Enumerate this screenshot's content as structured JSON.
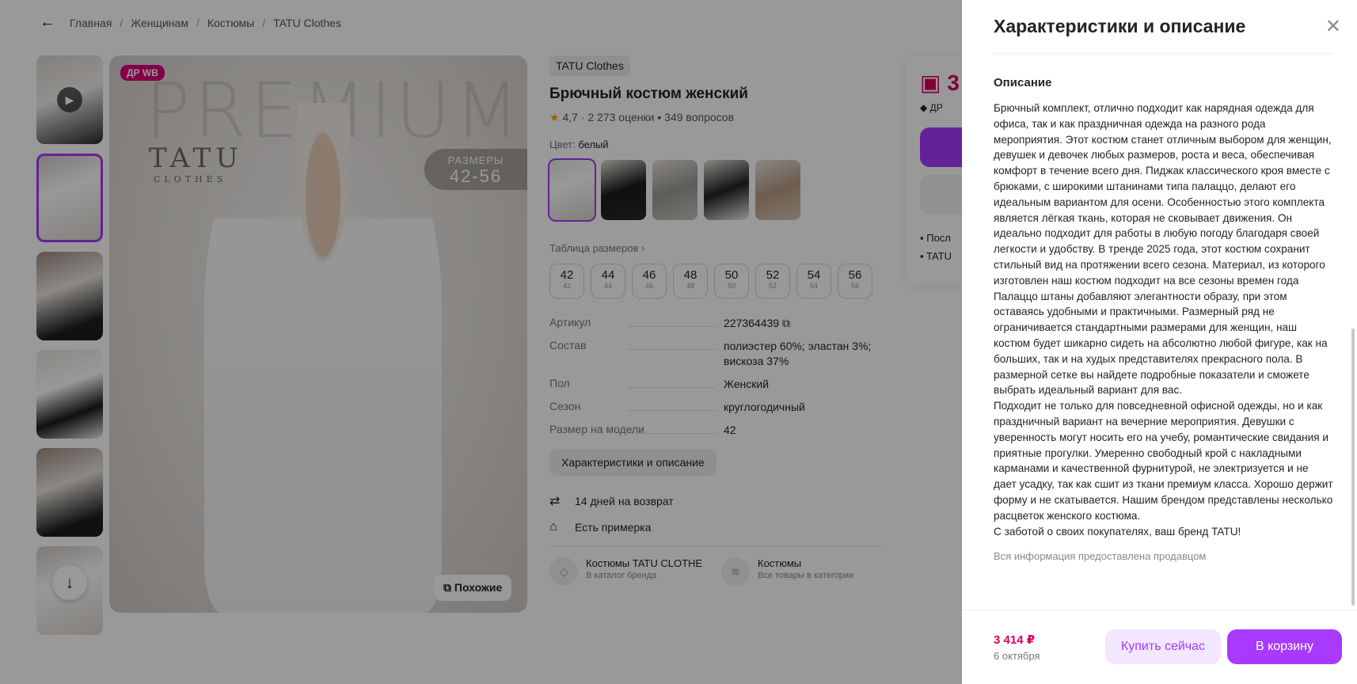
{
  "breadcrumbs": [
    "Главная",
    "Женщинам",
    "Костюмы",
    "TATU Clothes"
  ],
  "gallery": {
    "badge": "ДР WB",
    "watermark": "PREMIUM",
    "brand_logo": "TATU",
    "brand_logo_sub": "CLOTHES",
    "sizes_title": "РАЗМЕРЫ",
    "sizes_range": "42-56",
    "similar_label": "Похожие"
  },
  "product": {
    "brand": "TATU Clothes",
    "title": "Брючный костюм женский",
    "rating": "4,7",
    "reviews": "2 273 оценки",
    "questions": "349 вопросов",
    "color_label": "Цвет:",
    "color_value": "белый",
    "size_table_link": "Таблица размеров",
    "sizes": [
      {
        "ru": "42",
        "alt": "42"
      },
      {
        "ru": "44",
        "alt": "44"
      },
      {
        "ru": "46",
        "alt": "46"
      },
      {
        "ru": "48",
        "alt": "48"
      },
      {
        "ru": "50",
        "alt": "50"
      },
      {
        "ru": "52",
        "alt": "52"
      },
      {
        "ru": "54",
        "alt": "54"
      },
      {
        "ru": "56",
        "alt": "56"
      }
    ],
    "specs": [
      {
        "k": "Артикул",
        "v": "227364439"
      },
      {
        "k": "Состав",
        "v": "полиэстер 60%; эластан 3%; вискоза 37%"
      },
      {
        "k": "Пол",
        "v": "Женский"
      },
      {
        "k": "Сезон",
        "v": "круглогодичный"
      },
      {
        "k": "Размер на модели",
        "v": "42"
      }
    ],
    "char_button": "Характеристики и описание",
    "perks": [
      "14 дней на возврат",
      "Есть примерка"
    ],
    "categories": [
      {
        "title": "Костюмы TATU CLOTHE",
        "sub": "В каталог бренда"
      },
      {
        "title": "Костюмы",
        "sub": "Все товары в категории"
      }
    ]
  },
  "buy_card": {
    "price_fragment": "3",
    "badge_fragment": "ДР",
    "line1": "Посл",
    "line2": "TATU"
  },
  "drawer": {
    "title": "Характеристики и описание",
    "section_title": "Описание",
    "description": "Брючный комплект, отлично подходит как нарядная одежда для офиса, так и как праздничная одежда на разного рода мероприятия. Этот костюм станет отличным выбором для женщин, девушек и девочек любых размеров, роста и веса, обеспечивая комфорт в течение всего дня. Пиджак классического кроя вместе с брюками, с широкими штанинами типа палаццо, делают его идеальным вариантом для осени. Особенностью этого комплекта является лёгкая ткань, которая не сковывает движения. Он идеально подходит для работы в любую погоду благодаря своей легкости и удобству. В тренде 2025 года, этот костюм сохранит стильный вид на протяжении всего сезона. Материал, из которого изготовлен наш костюм подходит на все сезоны времен года Палаццо штаны добавляют элегантности образу, при этом оставаясь удобными и практичными. Размерный ряд не ограничивается стандартными размерами для женщин, наш костюм будет шикарно сидеть на абсолютно любой фигуре, как на больших, так и на худых представителях прекрасного пола. В размерной сетке вы найдете подробные показатели и сможете выбрать идеальный вариант для вас.\nПодходит не только для повседневной офисной одежды, но и как праздничный вариант на вечерние мероприятия. Девушки с уверенность могут носить его на учебу, романтические свидания и приятные прогулки. Умеренно свободный крой с накладными карманами и качественной фурнитурой, не электризуется и не дает усадку, так как сшит из ткани премиум класса. Хорошо держит форму и не скатывается. Нашим брендом представлены несколько расцветок женского костюма.\nС заботой о своих покупателях, ваш бренд TATU!",
    "seller_note": "Вся информация предоставлена продавцом",
    "footer": {
      "price": "3 414 ₽",
      "date": "6 октября",
      "buy_now": "Купить сейчас",
      "add_to_cart": "В корзину"
    }
  },
  "colors": {
    "accent": "#a73afd",
    "price": "#d7005a",
    "badge": "#d9007a"
  }
}
